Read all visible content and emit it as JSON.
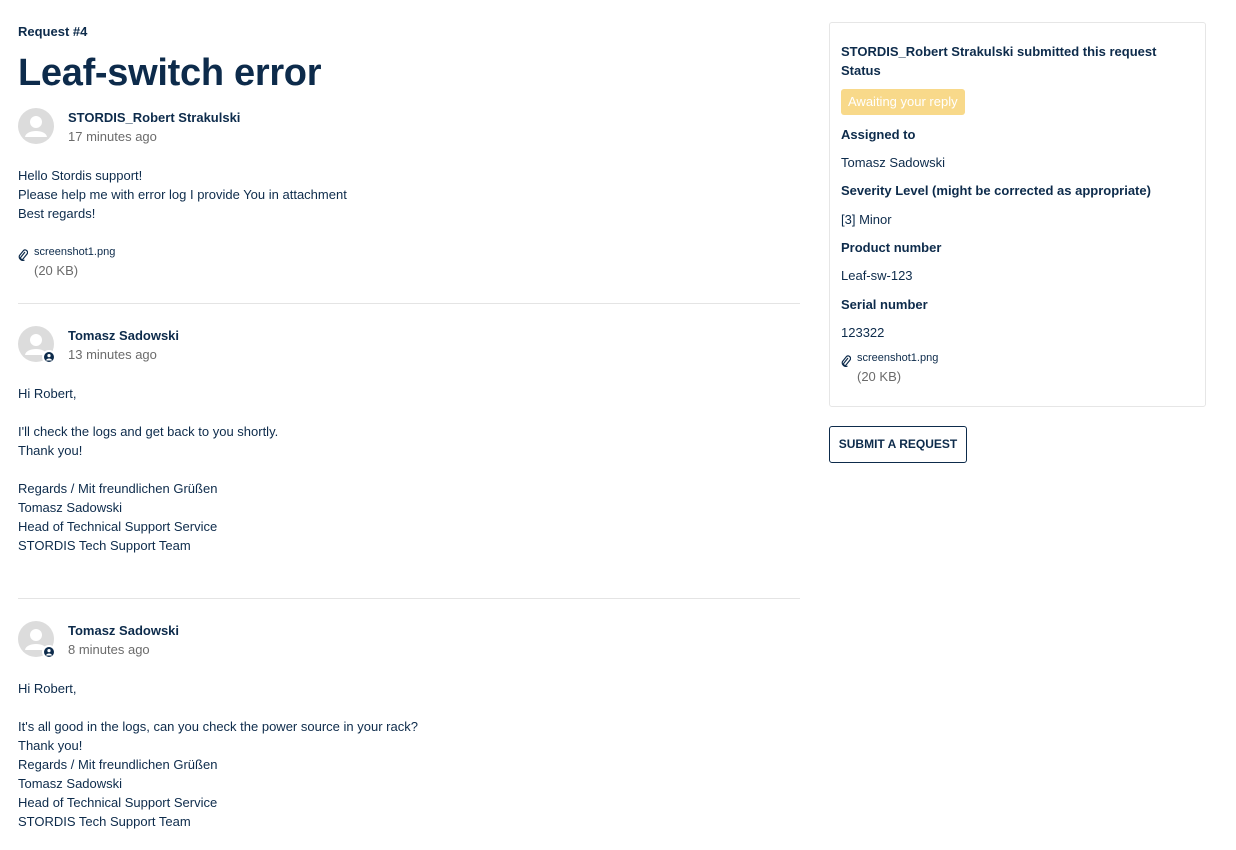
{
  "request": {
    "number_label": "Request #4",
    "title": "Leaf-switch error"
  },
  "comments": [
    {
      "author": "STORDIS_Robert Strakulski",
      "time": "17 minutes ago",
      "lines": [
        "Hello Stordis support!",
        "Please help me with error log I provide You in attachment",
        "Best regards!"
      ],
      "attachment": {
        "name": "screenshot1.png",
        "size": "(20 KB)"
      }
    },
    {
      "author": "Tomasz Sadowski",
      "time": "13 minutes ago",
      "lines": [
        "Hi Robert,",
        "",
        "I'll check the logs and get back to you shortly.",
        "Thank you!",
        "",
        "Regards / Mit freundlichen Grüßen",
        "Tomasz Sadowski",
        "Head of Technical Support Service",
        "STORDIS Tech Support Team"
      ]
    },
    {
      "author": "Tomasz Sadowski",
      "time": "8 minutes ago",
      "lines": [
        "Hi Robert,",
        "",
        "It's all good in the logs, can you check the power source in your rack?",
        "Thank you!",
        "Regards / Mit freundlichen Grüßen",
        "Tomasz Sadowski",
        "Head of Technical Support Service",
        "STORDIS Tech Support Team"
      ]
    }
  ],
  "sidebar": {
    "submitted_by": "STORDIS_Robert Strakulski submitted this request",
    "status_label": "Status",
    "status_value": "Awaiting your reply",
    "assigned_label": "Assigned to",
    "assigned_value": "Tomasz Sadowski",
    "severity_label": "Severity Level (might be corrected as appropriate)",
    "severity_value": "[3] Minor",
    "product_label": "Product number",
    "product_value": "Leaf-sw-123",
    "serial_label": "Serial number",
    "serial_value": "123322",
    "attachment": {
      "name": "screenshot1.png",
      "size": "(20 KB)"
    }
  },
  "submit_button_label": "SUBMIT A REQUEST",
  "colors": {
    "text_primary": "#0d2b4b",
    "text_muted": "#6b6b6b",
    "status_badge_bg": "#f8d98a",
    "avatar_bg": "#dcdcdc"
  },
  "icons": [
    "user-avatar-icon",
    "agent-badge-icon",
    "paperclip-icon"
  ]
}
